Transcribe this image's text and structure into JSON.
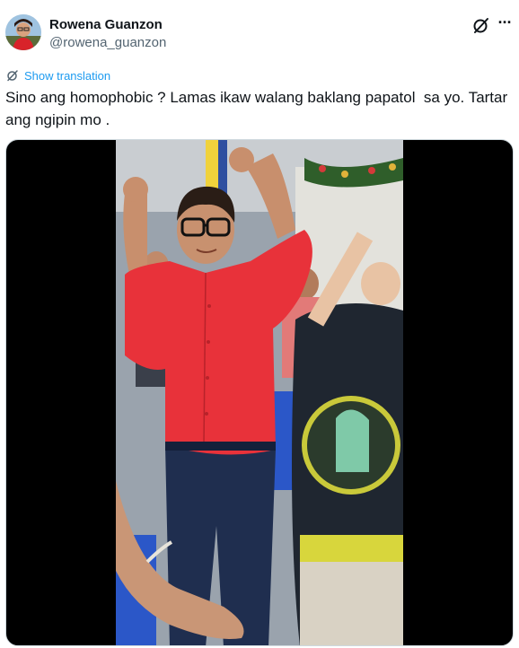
{
  "author": {
    "display_name": "Rowena Guanzon",
    "handle": "@rowena_guanzon"
  },
  "actions": {
    "grok_icon": "grok-icon",
    "more_icon": "more-icon",
    "more_glyph": "···"
  },
  "translation": {
    "label": "Show translation",
    "icon": "translate-icon"
  },
  "tweet": {
    "text": "Sino ang homophobic ? Lamas ikaw walang baklang papatol  sa yo. Tartar ang ngipin mo ."
  },
  "colors": {
    "accent": "#1d9bf0",
    "text": "#0f1419",
    "secondary": "#536471",
    "shirt_red": "#e8323a"
  }
}
